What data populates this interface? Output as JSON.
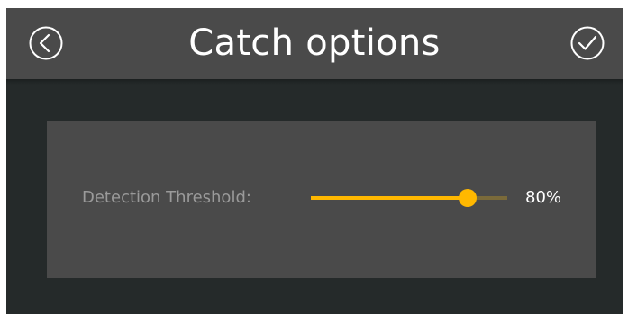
{
  "header": {
    "title": "Catch options",
    "back_icon": "chevron-left-circle-icon",
    "confirm_icon": "check-circle-icon"
  },
  "settings": {
    "detection_threshold": {
      "label": "Detection Threshold:",
      "value": 0.8,
      "value_text": "80%"
    }
  },
  "colors": {
    "accent": "#ffb800",
    "header_bg": "#4a4a4a",
    "app_bg": "#252a2a",
    "panel_bg": "#4a4a4a",
    "label_text": "#9a9a9a",
    "value_text": "#ffffff"
  }
}
